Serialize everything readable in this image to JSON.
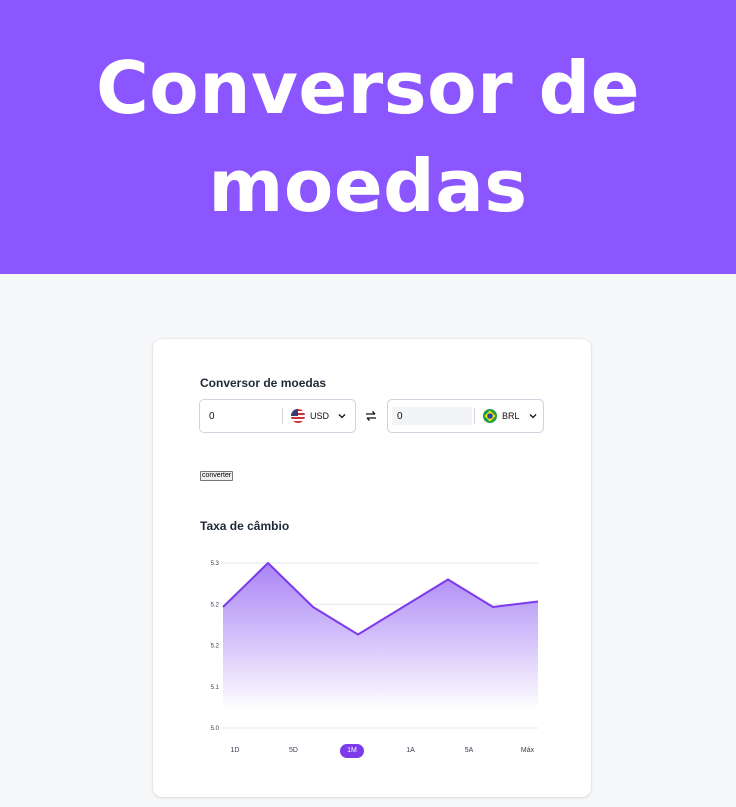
{
  "hero": {
    "title": "Conversor de moedas"
  },
  "converter": {
    "title": "Conversor de moedas",
    "from": {
      "value": "0",
      "currency": "USD",
      "flag": "us-flag-icon"
    },
    "to": {
      "value": "0",
      "currency": "BRL",
      "flag": "brazil-flag-icon"
    },
    "button_label": "converter"
  },
  "chart_section": {
    "title": "Taxa de câmbio",
    "y_ticks": [
      "5.3",
      "5.2",
      "5.2",
      "5.1",
      "5.0"
    ],
    "periods": [
      "1D",
      "5D",
      "1M",
      "1A",
      "5A",
      "Máx"
    ],
    "active_period": "1M"
  },
  "chart_data": {
    "type": "area",
    "ylim": [
      5.0,
      5.3
    ],
    "y_ticks": [
      5.3,
      5.2,
      5.2,
      5.1,
      5.0
    ],
    "x": [
      0,
      1,
      2,
      3,
      4,
      5,
      6,
      7
    ],
    "values": [
      5.22,
      5.3,
      5.22,
      5.17,
      5.22,
      5.27,
      5.22,
      5.23
    ],
    "grid": true,
    "colors": {
      "line": "#7c3aed",
      "fill_top": "#a57ef5",
      "fill_bottom": "#ffffff"
    }
  },
  "colors": {
    "brand": "#8b55ff",
    "accent": "#7c3aed"
  }
}
